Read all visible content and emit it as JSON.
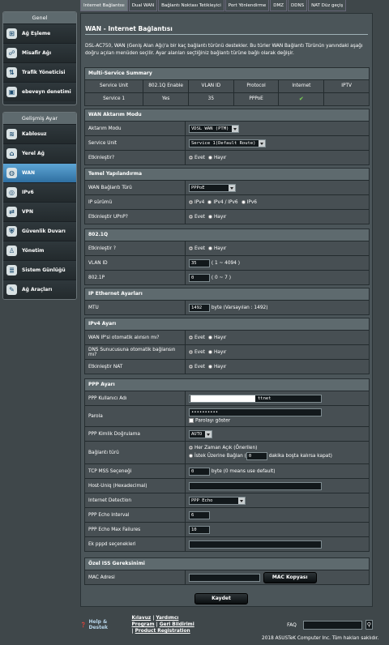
{
  "tabs": [
    "Internet Bağlantısı",
    "Dual WAN",
    "Bağlantı Noktası Tetikleyici",
    "Port Yönlendirme",
    "DMZ",
    "DDNS",
    "NAT Düz geçiş"
  ],
  "sidebar": {
    "general_title": "Genel",
    "general": [
      {
        "label": "Ağ Eşleme",
        "icon": "network-map-icon"
      },
      {
        "label": "Misafir Ağı",
        "icon": "guest-network-icon"
      },
      {
        "label": "Trafik Yöneticisi",
        "icon": "traffic-manager-icon"
      },
      {
        "label": "ebeveyn denetimi",
        "icon": "lock-icon"
      }
    ],
    "advanced_title": "Gelişmiş Ayar",
    "advanced": [
      {
        "label": "Kablosuz",
        "icon": "wireless-icon"
      },
      {
        "label": "Yerel Ağ",
        "icon": "home-icon"
      },
      {
        "label": "WAN",
        "icon": "globe-icon"
      },
      {
        "label": "IPv6",
        "icon": "ipv6-icon"
      },
      {
        "label": "VPN",
        "icon": "vpn-icon"
      },
      {
        "label": "Güvenlik Duvarı",
        "icon": "firewall-icon"
      },
      {
        "label": "Yönetim",
        "icon": "admin-icon"
      },
      {
        "label": "Sistem Günlüğü",
        "icon": "log-icon"
      },
      {
        "label": "Ağ Araçları",
        "icon": "tools-icon"
      }
    ]
  },
  "page": {
    "title": "WAN - Internet Bağlantısı",
    "desc": "DSL-AC750, WAN (Geniş Alan Ağı)'a bir kaç bağlantı türünü destekler. Bu türler WAN Bağlantı Türünün yanındaki aşağı doğru açılan menüden seçilir. Ayar alanları seçtiğiniz bağlantı türüne bağlı olarak değişir."
  },
  "ms": {
    "title": "Multi-Service Summary",
    "headers": [
      "Service Unit",
      "802.1Q Enable",
      "VLAN ID",
      "Protocol",
      "Internet",
      "IPTV"
    ],
    "row": [
      "Service 1",
      "Yes",
      "35",
      "PPPoE",
      "",
      ""
    ]
  },
  "wan": {
    "title": "WAN Aktarım Modu",
    "mode_label": "Aktarım Modu",
    "mode": "VDSL WAN (PTM)",
    "unit_label": "Service Unit",
    "unit": "Service 1(Default Route)",
    "enable_label": "Etkinleştir?",
    "evet": "Evet",
    "hayir": "Hayır"
  },
  "basic": {
    "title": "Temel Yapılandırma",
    "type_label": "WAN Bağlantı Türü",
    "type": "PPPoE",
    "ip_label": "IP sürümü",
    "ipv4": "IPv4",
    "ipv46": "IPv4 / IPv6",
    "ipv6": "IPv6",
    "upnp_label": "Etkinleştir UPnP?"
  },
  "dot1q": {
    "title": "802.1Q",
    "enable_label": "Etkinleştir ?",
    "vlan_label": "VLAN ID",
    "vlan": "35",
    "vlan_hint": "( 1 ~ 4094 )",
    "p_label": "802.1P",
    "p": "0",
    "p_hint": "( 0 ~ 7 )"
  },
  "eth": {
    "title": "IP Ethernet Ayarları",
    "mtu_label": "MTU",
    "mtu": "1492",
    "mtu_hint": "byte (Varsayılan : 1492)"
  },
  "ipv4": {
    "title": "IPv4 Ayarı",
    "auto_ip": "WAN IP'si otomatik alınsın mı?",
    "auto_dns": "DNS Sunucusuna otomatik bağlansın mı?",
    "nat": "Etkinleştir NAT"
  },
  "ppp": {
    "title": "PPP Ayarı",
    "user_label": "PPP Kullanıcı Adı",
    "user": "ttnet",
    "pass_label": "Parola",
    "pass": "••••••••••",
    "show": "Parolayı göster",
    "auth_label": "PPP Kimlik Doğrulama",
    "auth": "AUTO",
    "conn_label": "Bağlantı türü",
    "always": "Her Zaman Açık (Önerilen)",
    "ondemand": "İstek Üzerine Bağlan (",
    "idle": "0",
    "idle_hint": "dakika boşta kalırsa kapat)",
    "mss_label": "TCP MSS Seçeneği",
    "mss": "0",
    "mss_hint": "byte (0 means use default)",
    "host_label": "Host-Uniq (Hexadecimal)",
    "det_label": "Internet Detection",
    "det": "PPP Echo",
    "echo_label": "PPP Echo Interval",
    "echo": "6",
    "fail_label": "PPP Echo Max Failures",
    "fail": "10",
    "extra_label": "Ek pppd seçenekleri"
  },
  "isp": {
    "title": "Özel ISS Gereksinimi",
    "mac_label": "MAC Adresi",
    "clone": "MAC Kopyası"
  },
  "apply": "Kaydet",
  "footer": {
    "help": "Help & Destek",
    "l1": "Kılavuz",
    "l2": "Yardımcı Program",
    "l3": "Geri Bildirimi",
    "l4": "Product Registration",
    "faq": "FAQ",
    "copy": "2018 ASUSTeK Computer Inc. Tüm hakları saklıdır."
  }
}
